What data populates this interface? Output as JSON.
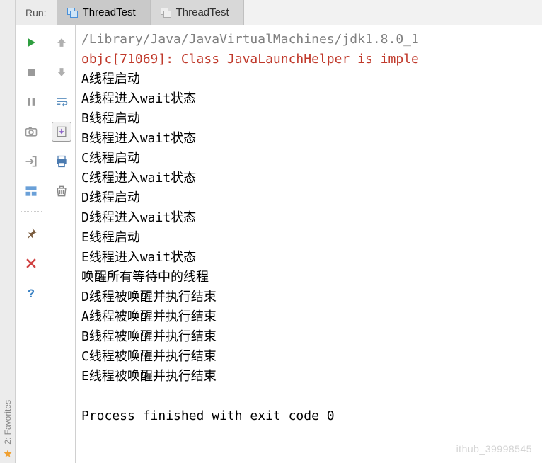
{
  "header": {
    "run_label": "Run:",
    "tabs": [
      {
        "label": "ThreadTest",
        "active": true
      },
      {
        "label": "ThreadTest",
        "active": false
      }
    ]
  },
  "left_toolbar_a": {
    "run": "run-icon",
    "stop": "stop-icon",
    "pause": "pause-icon",
    "dump": "camera-icon",
    "exit": "exit-icon",
    "layout": "layout-icon",
    "pin": "pin-icon",
    "close": "close-icon",
    "help": "help-icon"
  },
  "left_toolbar_b": {
    "up": "arrow-up-icon",
    "down": "arrow-down-icon",
    "wrap": "wrap-icon",
    "scroll": "scroll-to-end-icon",
    "print": "print-icon",
    "clear": "trash-icon"
  },
  "console": {
    "lines": [
      {
        "text": "/Library/Java/JavaVirtualMachines/jdk1.8.0_1",
        "cls": "line-gray"
      },
      {
        "text": "objc[71069]: Class JavaLaunchHelper is imple",
        "cls": "line-red"
      },
      {
        "text": "A线程启动",
        "cls": "line-black"
      },
      {
        "text": "A线程进入wait状态",
        "cls": "line-black"
      },
      {
        "text": "B线程启动",
        "cls": "line-black"
      },
      {
        "text": "B线程进入wait状态",
        "cls": "line-black"
      },
      {
        "text": "C线程启动",
        "cls": "line-black"
      },
      {
        "text": "C线程进入wait状态",
        "cls": "line-black"
      },
      {
        "text": "D线程启动",
        "cls": "line-black"
      },
      {
        "text": "D线程进入wait状态",
        "cls": "line-black"
      },
      {
        "text": "E线程启动",
        "cls": "line-black"
      },
      {
        "text": "E线程进入wait状态",
        "cls": "line-black"
      },
      {
        "text": "唤醒所有等待中的线程",
        "cls": "line-black"
      },
      {
        "text": "D线程被唤醒并执行结束",
        "cls": "line-black"
      },
      {
        "text": "A线程被唤醒并执行结束",
        "cls": "line-black"
      },
      {
        "text": "B线程被唤醒并执行结束",
        "cls": "line-black"
      },
      {
        "text": "C线程被唤醒并执行结束",
        "cls": "line-black"
      },
      {
        "text": "E线程被唤醒并执行结束",
        "cls": "line-black"
      },
      {
        "text": "",
        "cls": "line-black"
      },
      {
        "text": "Process finished with exit code 0",
        "cls": "line-black"
      }
    ]
  },
  "sidebar_edge": {
    "label": "2: Favorites"
  },
  "watermark": "ithub_39998545"
}
